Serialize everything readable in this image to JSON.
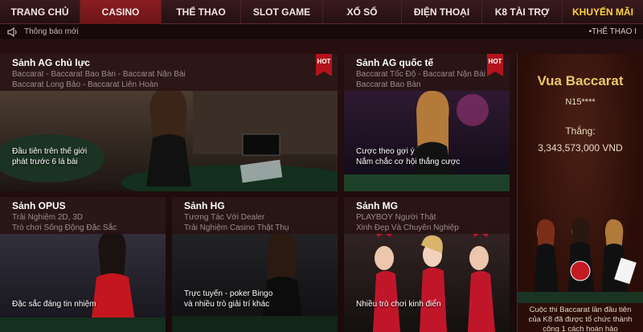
{
  "nav": {
    "items": [
      {
        "label": "TRANG CHỦ"
      },
      {
        "label": "CASINO"
      },
      {
        "label": "THỂ THAO"
      },
      {
        "label": "SLOT GAME"
      },
      {
        "label": "XỔ SỐ"
      },
      {
        "label": "ĐIỆN THOẠI"
      },
      {
        "label": "K8 TÀI TRỢ"
      },
      {
        "label": "KHUYẾN MÃI"
      }
    ],
    "active_index": 1
  },
  "notice": {
    "label": "Thông báo mới",
    "ticker": "•THỂ THAO I"
  },
  "cards": {
    "ag_main": {
      "title": "Sảnh AG chủ lực",
      "sub1": "Baccarat - Baccarat Bao Bàn - Baccarat Nặn Bài",
      "sub2": "Baccarat Long Bảo - Baccarat Liên Hoàn",
      "caption1": "Đầu tiên trên thế giới",
      "caption2": "phát trước 6 lá bài",
      "badge": "HOT"
    },
    "ag_intl": {
      "title": "Sảnh AG quốc tế",
      "sub1": "Baccarat Tốc Độ - Baccarat Nặn Bài -",
      "sub2": "Baccarat Bao Bàn",
      "caption1": "Cược theo gợi ý",
      "caption2": "Nắm chắc cơ hội thắng cược",
      "badge": "HOT"
    },
    "opus": {
      "title": "Sảnh OPUS",
      "sub1": "Trải Nghiệm 2D, 3D",
      "sub2": "Trò chơi Sống Động Đặc Sắc",
      "caption1": "Đặc sắc đáng tin nhiệm"
    },
    "hg": {
      "title": "Sảnh HG",
      "sub1": "Tương Tác Với Dealer",
      "sub2": "Trải Nghiệm Casino Thật Thụ",
      "caption1": "Trực tuyến - poker Bingo",
      "caption2": "và nhiều trò giải trí khác"
    },
    "mg": {
      "title": "Sảnh MG",
      "sub1": "PLAYBOY Người Thật",
      "sub2": "Xinh Đẹp Và Chuyên Nghiệp",
      "caption1": "Nhiều trò chơi kinh điển"
    }
  },
  "promo": {
    "title": "Vua Baccarat",
    "user": "N15****",
    "win_label": "Thắng:",
    "amount": "3,343,573,000 VND",
    "note1": "Cuộc thi Baccarat lần đầu tiên",
    "note2": "của K8 đã được tổ chức thành",
    "note3": "công 1 cách hoàn hảo"
  },
  "colors": {
    "accent_red": "#8a1e22",
    "promo_yellow": "#ffd23c",
    "hot_badge": "#b3131d"
  }
}
